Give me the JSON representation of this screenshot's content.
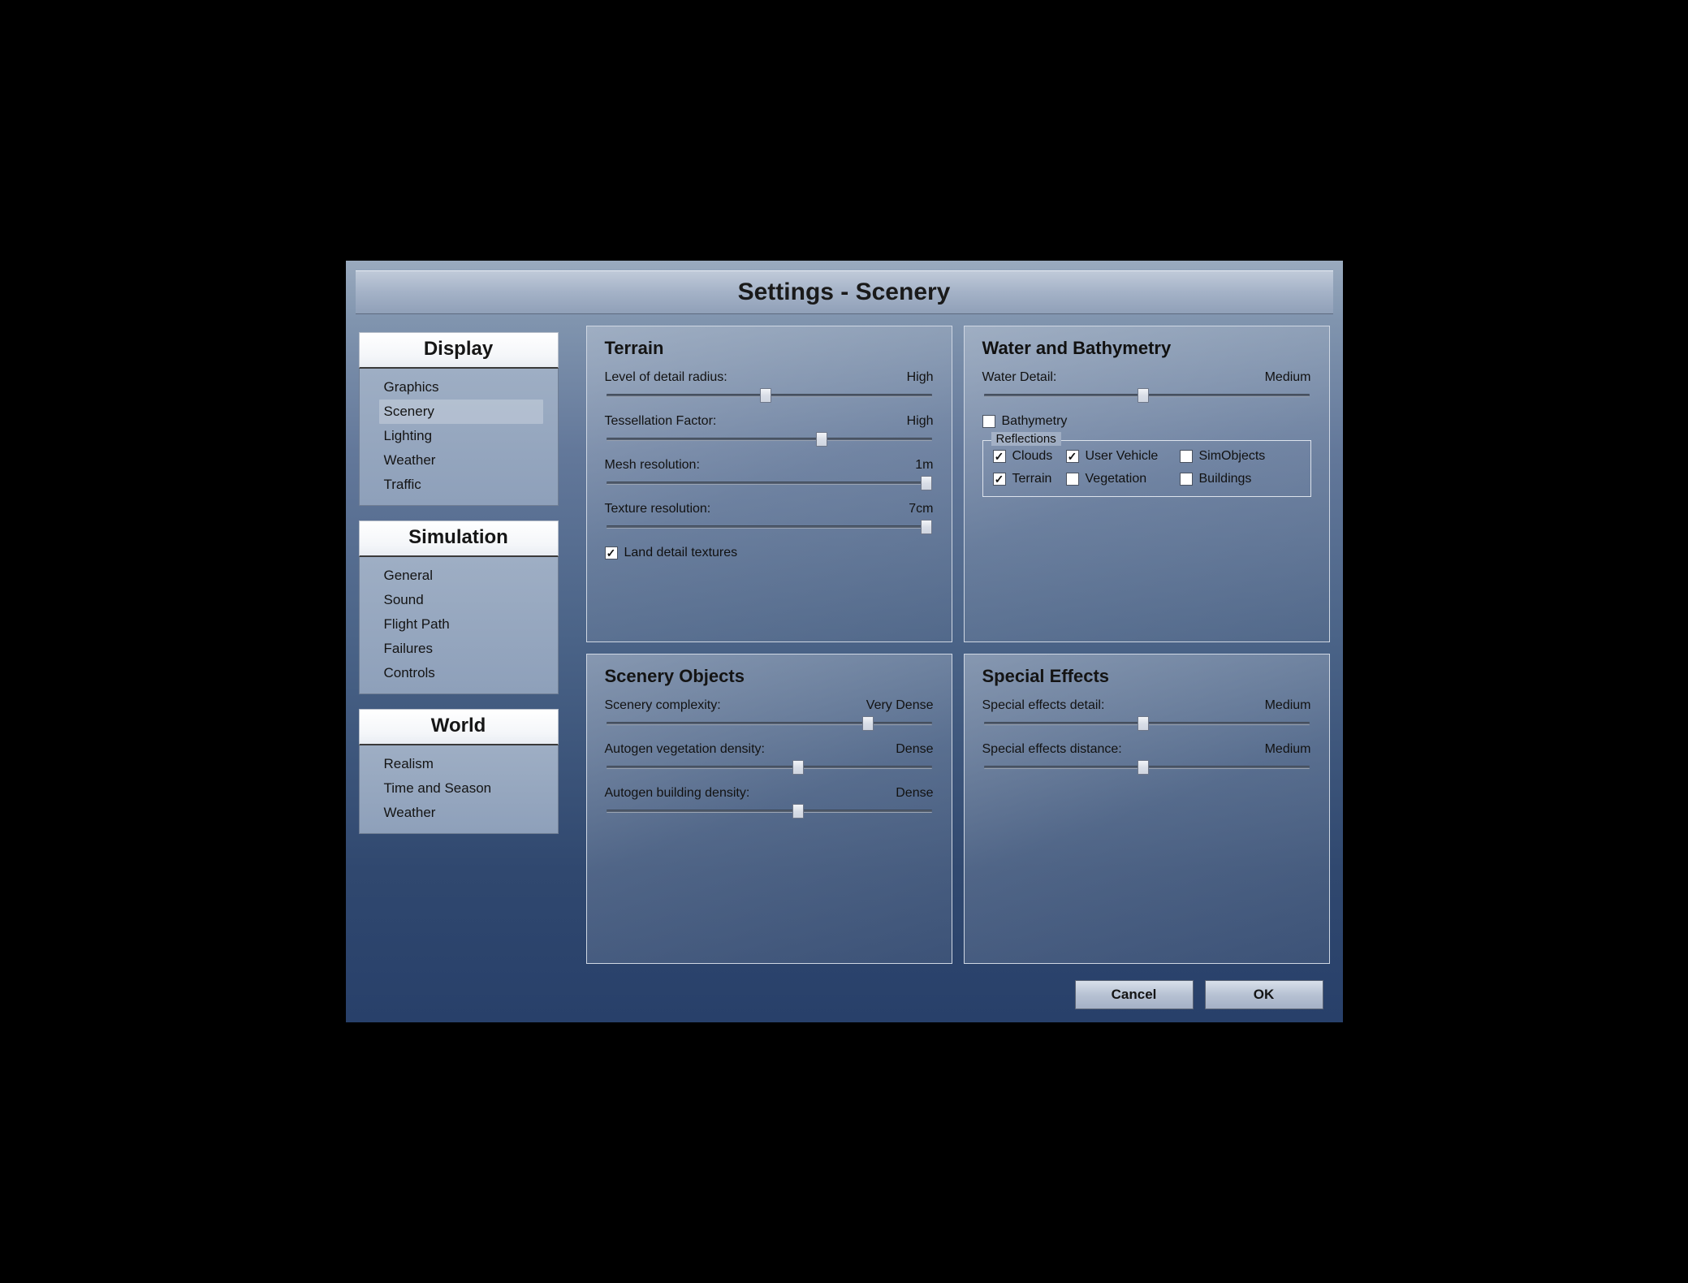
{
  "title": "Settings - Scenery",
  "sidebar": {
    "groups": [
      {
        "header": "Display",
        "items": [
          "Graphics",
          "Scenery",
          "Lighting",
          "Weather",
          "Traffic"
        ],
        "active_index": 1
      },
      {
        "header": "Simulation",
        "items": [
          "General",
          "Sound",
          "Flight Path",
          "Failures",
          "Controls"
        ],
        "active_index": -1
      },
      {
        "header": "World",
        "items": [
          "Realism",
          "Time and Season",
          "Weather"
        ],
        "active_index": -1
      }
    ]
  },
  "panels": {
    "terrain": {
      "title": "Terrain",
      "sliders": [
        {
          "label": "Level of detail radius:",
          "value": "High",
          "pos": 49
        },
        {
          "label": "Tessellation Factor:",
          "value": "High",
          "pos": 66
        },
        {
          "label": "Mesh resolution:",
          "value": "1m",
          "pos": 98
        },
        {
          "label": "Texture resolution:",
          "value": "7cm",
          "pos": 98
        }
      ],
      "checkbox": {
        "label": "Land detail textures",
        "checked": true
      }
    },
    "water": {
      "title": "Water and Bathymetry",
      "sliders": [
        {
          "label": "Water Detail:",
          "value": "Medium",
          "pos": 49
        }
      ],
      "bathymetry": {
        "label": "Bathymetry",
        "checked": false
      },
      "reflections_title": "Reflections",
      "reflections": [
        {
          "label": "Clouds",
          "checked": true
        },
        {
          "label": "User Vehicle",
          "checked": true
        },
        {
          "label": "SimObjects",
          "checked": false
        },
        {
          "label": "Terrain",
          "checked": true
        },
        {
          "label": "Vegetation",
          "checked": false
        },
        {
          "label": "Buildings",
          "checked": false
        }
      ]
    },
    "scenery_objects": {
      "title": "Scenery Objects",
      "sliders": [
        {
          "label": "Scenery complexity:",
          "value": "Very Dense",
          "pos": 80
        },
        {
          "label": "Autogen vegetation density:",
          "value": "Dense",
          "pos": 59
        },
        {
          "label": "Autogen building density:",
          "value": "Dense",
          "pos": 59
        }
      ]
    },
    "special_effects": {
      "title": "Special Effects",
      "sliders": [
        {
          "label": "Special effects detail:",
          "value": "Medium",
          "pos": 49
        },
        {
          "label": "Special effects distance:",
          "value": "Medium",
          "pos": 49
        }
      ]
    }
  },
  "buttons": {
    "cancel": "Cancel",
    "ok": "OK"
  }
}
